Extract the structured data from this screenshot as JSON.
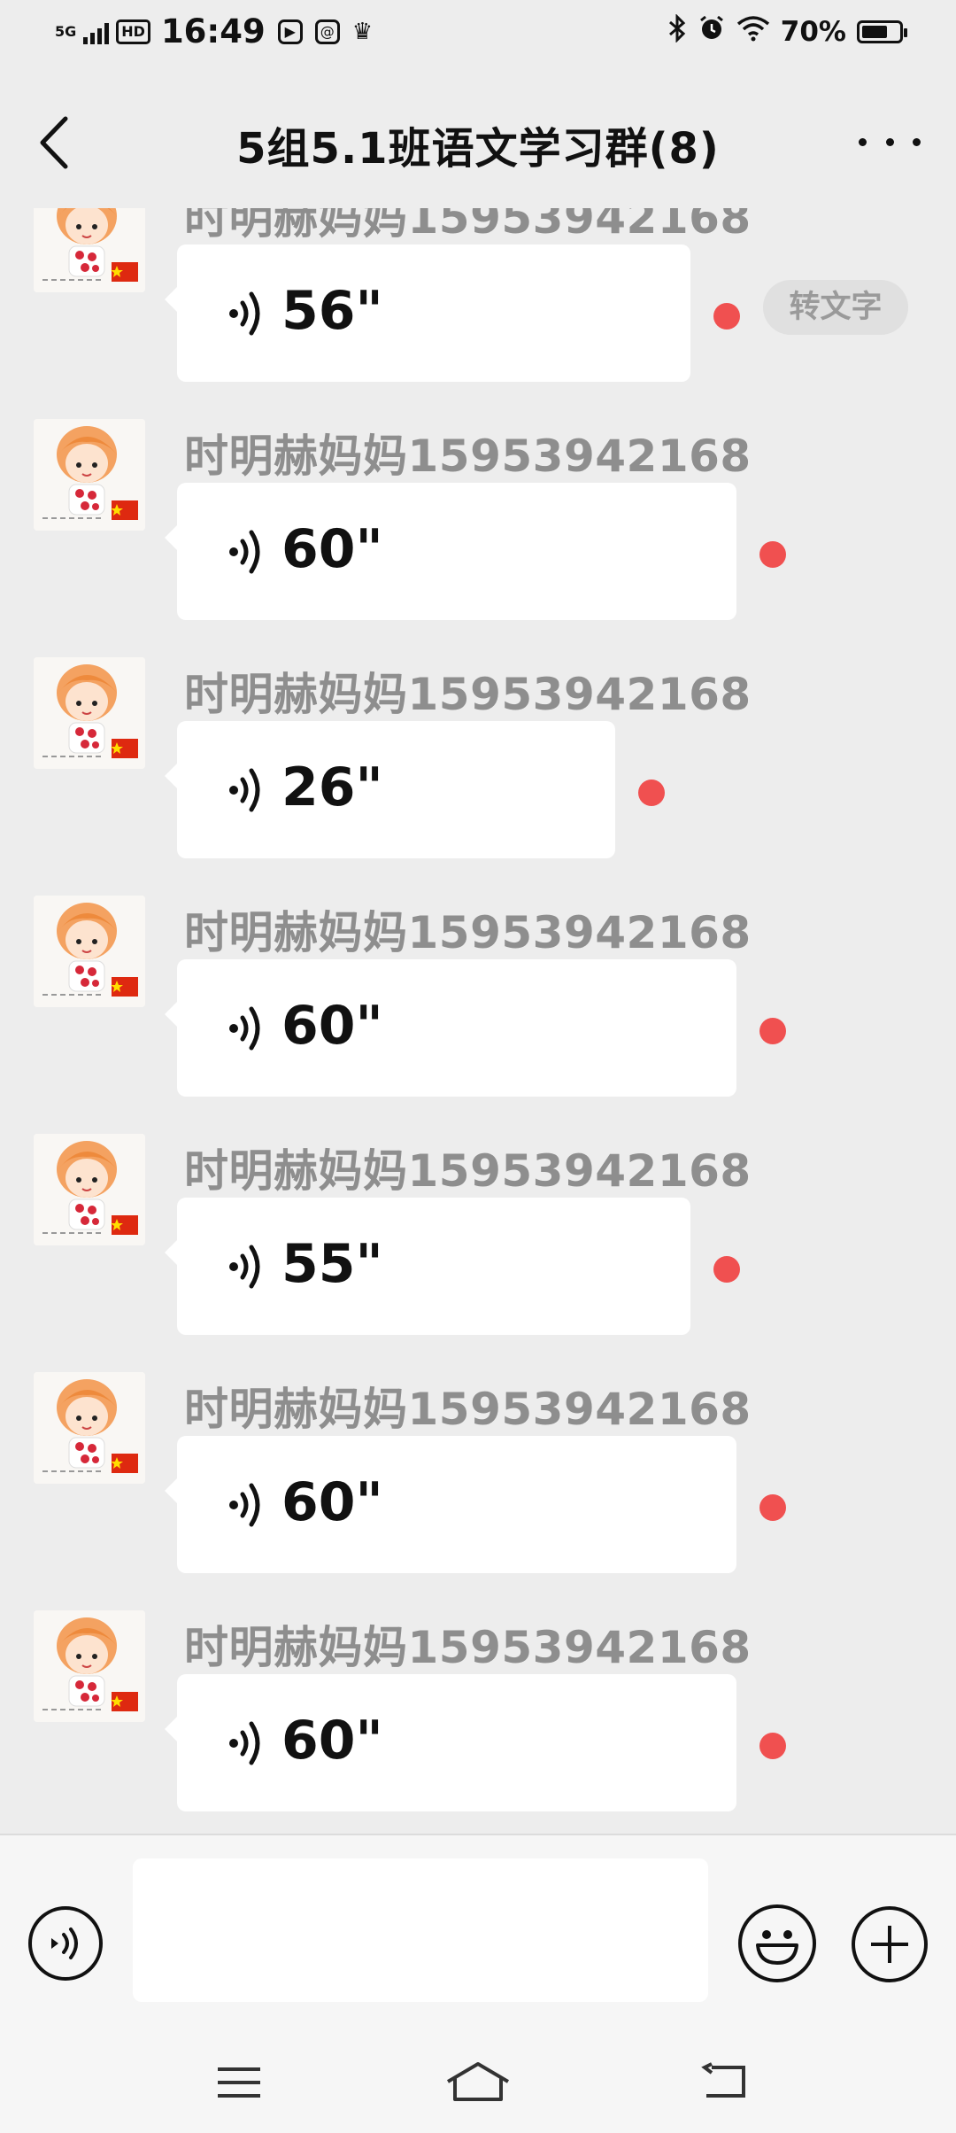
{
  "status_bar": {
    "network": "5G",
    "hd": "HD",
    "time": "16:49",
    "battery_percent": "70%",
    "battery_level": 0.7
  },
  "header": {
    "title": "5组5.1班语文学习群(8)"
  },
  "messages": [
    {
      "sender": "时明赫妈妈15953942168",
      "duration": "56\"",
      "to_text_label": "转文字"
    },
    {
      "sender": "时明赫妈妈15953942168",
      "duration": "60\""
    },
    {
      "sender": "时明赫妈妈15953942168",
      "duration": "26\""
    },
    {
      "sender": "时明赫妈妈15953942168",
      "duration": "60\""
    },
    {
      "sender": "时明赫妈妈15953942168",
      "duration": "55\""
    },
    {
      "sender": "时明赫妈妈15953942168",
      "duration": "60\""
    },
    {
      "sender": "时明赫妈妈15953942168",
      "duration": "60\""
    }
  ],
  "input": {
    "value": "",
    "placeholder": ""
  },
  "colors": {
    "background": "#ededed",
    "bubble": "#ffffff",
    "unread_dot": "#f05050",
    "sender_name": "#8e8e8e"
  },
  "icons": {
    "back": "chevron-left-icon",
    "more": "more-dots-icon",
    "voice": "voice-wave-icon",
    "emoji": "smile-emoji-icon",
    "plus": "plus-icon",
    "nav_menu": "menu-icon",
    "nav_home": "home-icon",
    "nav_back": "back-arrow-icon"
  }
}
